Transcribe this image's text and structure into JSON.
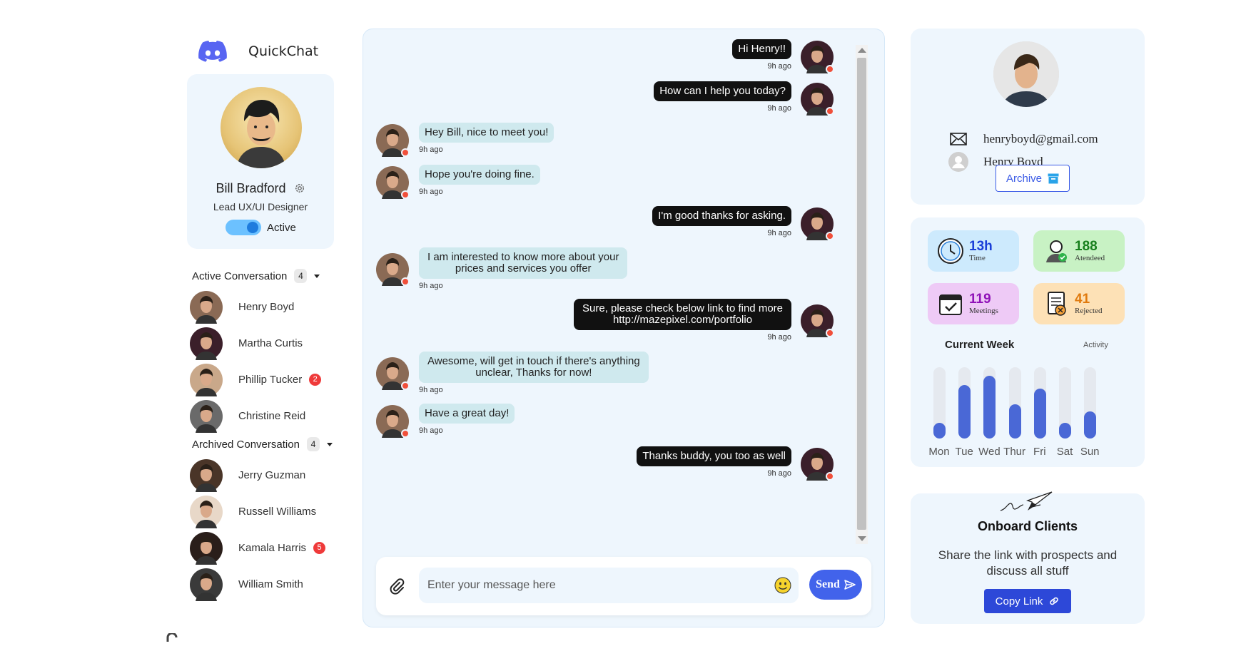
{
  "app": {
    "name": "QuickChat",
    "logo_icon": "discord-icon"
  },
  "profile": {
    "name": "Bill Bradford",
    "role": "Lead UX/UI Designer",
    "status_label": "Active",
    "status_on": true
  },
  "active_conversations": {
    "title": "Active Conversation",
    "count": "4",
    "items": [
      {
        "name": "Henry Boyd",
        "unread": ""
      },
      {
        "name": "Martha Curtis",
        "unread": ""
      },
      {
        "name": "Phillip Tucker",
        "unread": "2"
      },
      {
        "name": "Christine Reid",
        "unread": ""
      }
    ]
  },
  "archived_conversations": {
    "title": "Archived Conversation",
    "count": "4",
    "items": [
      {
        "name": "Jerry Guzman",
        "unread": ""
      },
      {
        "name": "Russell Williams",
        "unread": ""
      },
      {
        "name": "Kamala Harris",
        "unread": "5"
      },
      {
        "name": "William Smith",
        "unread": ""
      }
    ]
  },
  "messages": [
    {
      "dir": "out",
      "lines": [
        "Hi Henry!!"
      ],
      "time": "9h ago"
    },
    {
      "dir": "out",
      "lines": [
        "How can I help you today?"
      ],
      "time": "9h ago"
    },
    {
      "dir": "in",
      "lines": [
        "Hey Bill, nice to meet you!"
      ],
      "time": "9h ago"
    },
    {
      "dir": "in",
      "lines": [
        "Hope you're doing fine."
      ],
      "time": "9h ago"
    },
    {
      "dir": "out",
      "lines": [
        "I'm good thanks for asking."
      ],
      "time": "9h ago"
    },
    {
      "dir": "in",
      "lines": [
        "I am interested to know more about your",
        "prices and services you offer"
      ],
      "time": "9h ago"
    },
    {
      "dir": "out",
      "lines": [
        "Sure, please check below link to find more",
        "http://mazepixel.com/portfolio"
      ],
      "time": "9h ago"
    },
    {
      "dir": "in",
      "lines": [
        "Awesome, will get in touch if there's anything",
        "unclear, Thanks for now!"
      ],
      "time": "9h ago"
    },
    {
      "dir": "in",
      "lines": [
        "Have a great day!"
      ],
      "time": "9h ago"
    },
    {
      "dir": "out",
      "lines": [
        "Thanks buddy, you too as well"
      ],
      "time": "9h ago"
    }
  ],
  "composer": {
    "placeholder": "Enter your message here",
    "send_label": "Send"
  },
  "contact": {
    "email": "henryboyd@gmail.com",
    "name": "Henry Boyd",
    "archive_label": "Archive"
  },
  "stats": [
    {
      "value": "13h",
      "label": "Time",
      "icon": "clock-icon",
      "bg": "#cdeafd",
      "color": "#1a3fd8"
    },
    {
      "value": "188",
      "label": "Atendeed",
      "icon": "user-check-icon",
      "bg": "#c8f2c4",
      "color": "#18801d"
    },
    {
      "value": "119",
      "label": "Meetings",
      "icon": "calendar-check-icon",
      "bg": "#eecaf6",
      "color": "#9013b8"
    },
    {
      "value": "41",
      "label": "Rejected",
      "icon": "document-reject-icon",
      "bg": "#fde1b6",
      "color": "#e07a0e"
    }
  ],
  "week": {
    "title": "Current Week",
    "subtitle": "Activity"
  },
  "chart_data": {
    "type": "bar",
    "categories": [
      "Mon",
      "Tue",
      "Wed",
      "Thur",
      "Fri",
      "Sat",
      "Sun"
    ],
    "values": [
      22,
      75,
      88,
      48,
      70,
      22,
      38
    ],
    "ylim": [
      0,
      100
    ],
    "color": "#4a68d6"
  },
  "onboard": {
    "title": "Onboard Clients",
    "text": "Share the link with prospects and discuss all stuff",
    "button_label": "Copy Link"
  }
}
